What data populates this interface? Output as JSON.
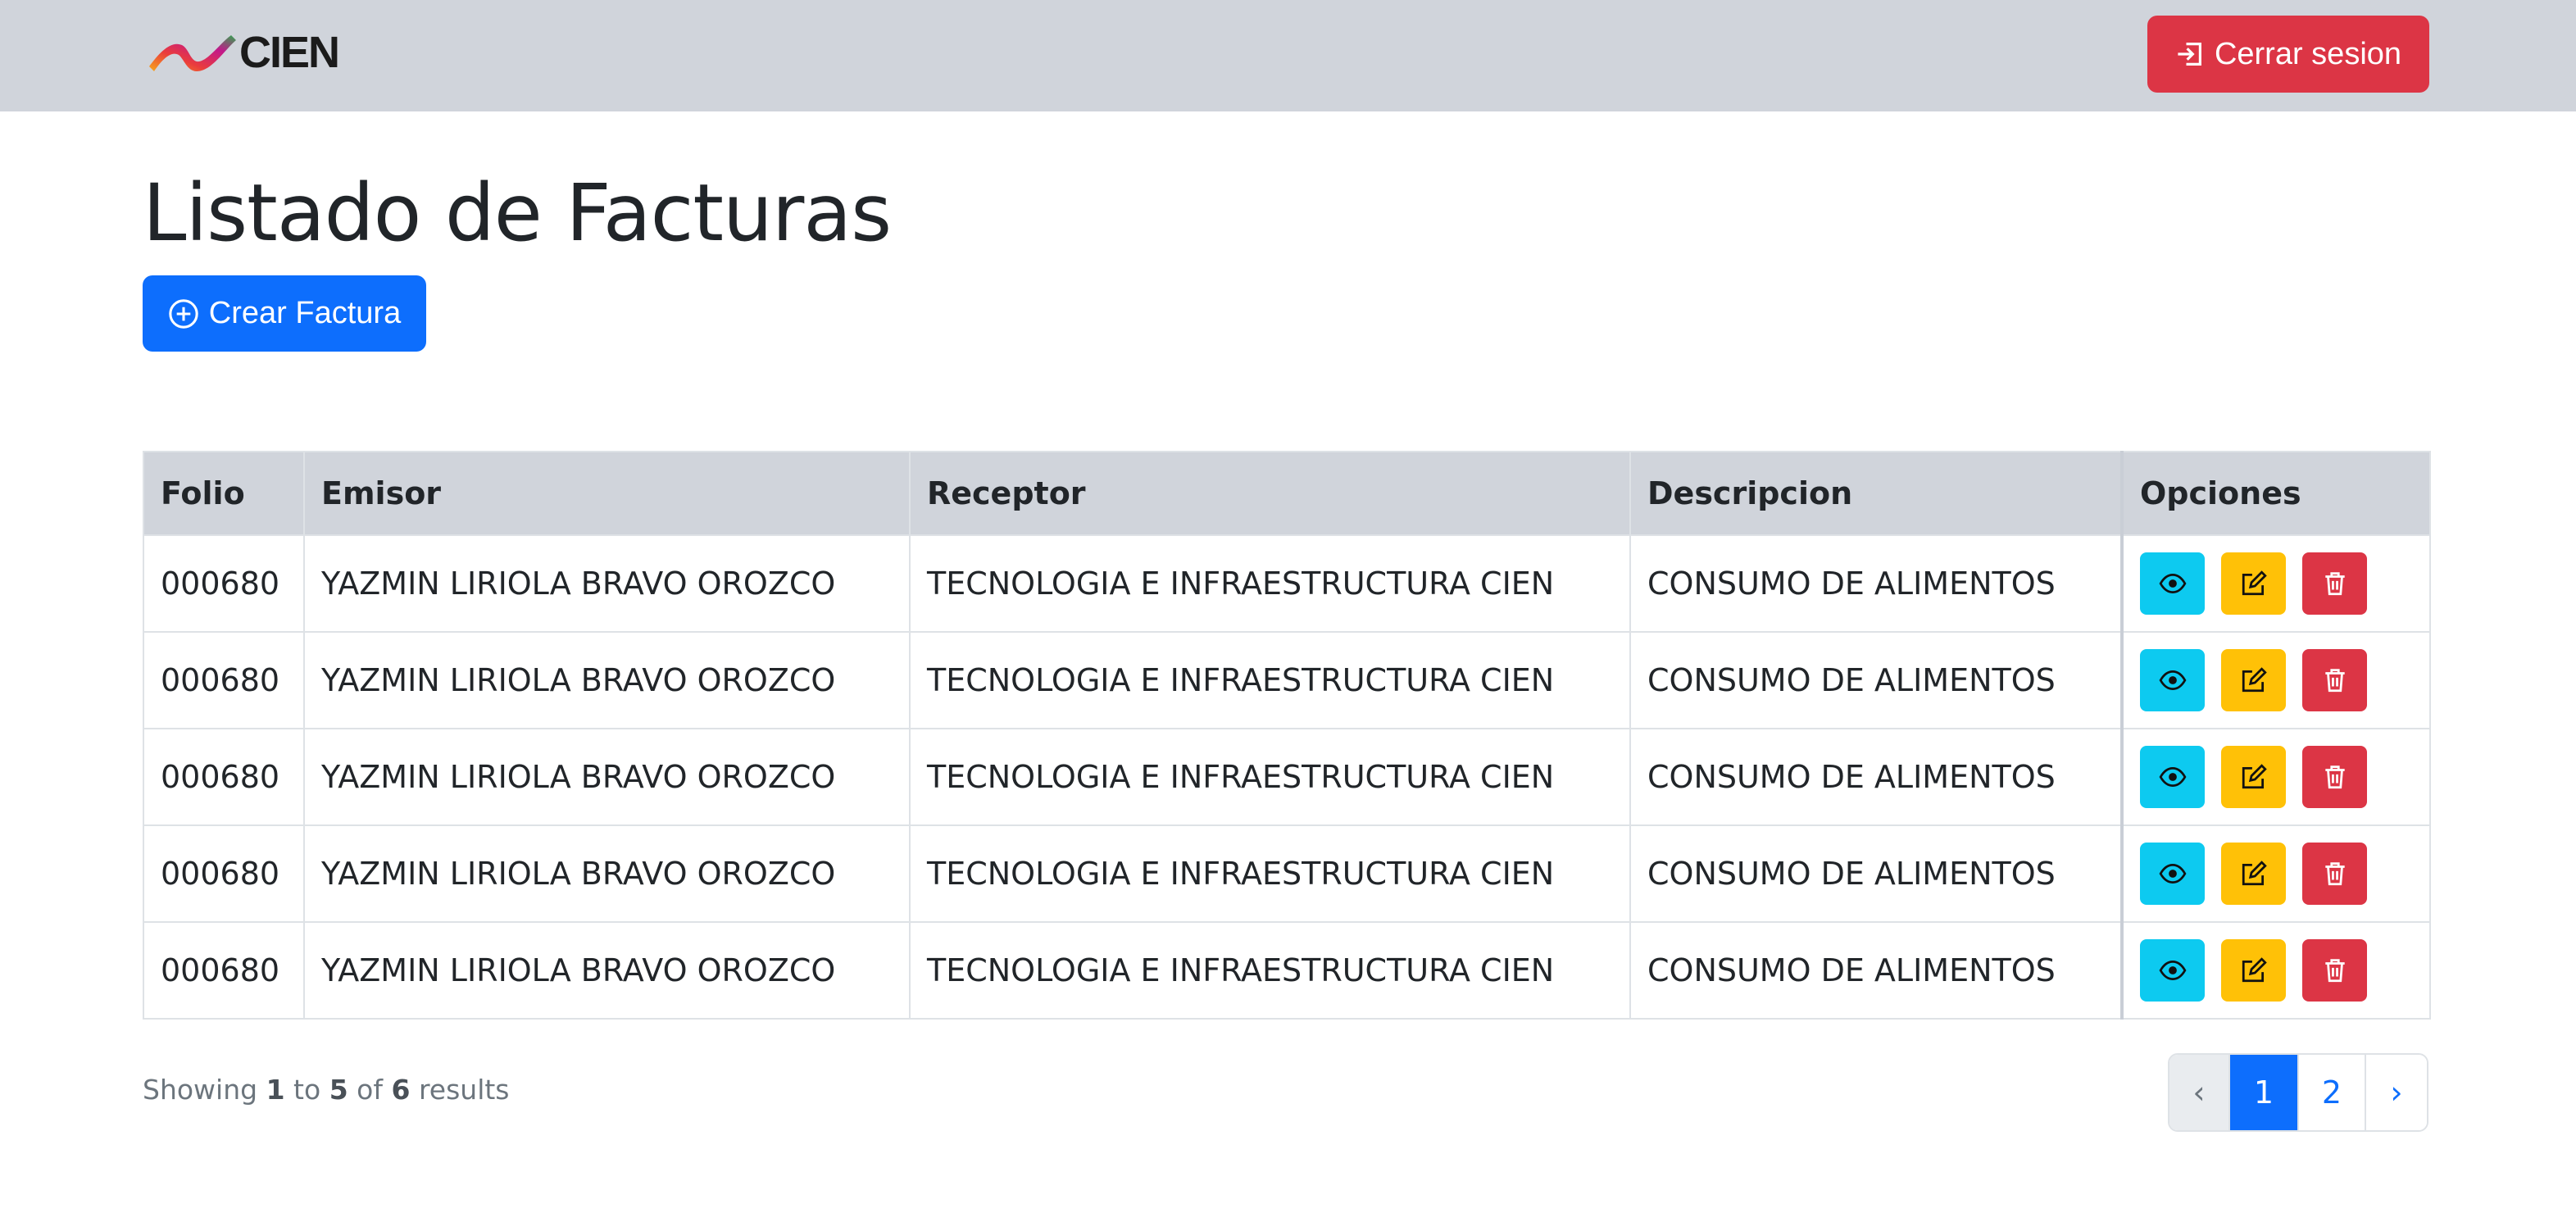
{
  "header": {
    "logo_text": "CIEN",
    "logout_label": "Cerrar sesion"
  },
  "main": {
    "title": "Listado de Facturas",
    "create_label": "Crear Factura"
  },
  "table": {
    "columns": [
      "Folio",
      "Emisor",
      "Receptor",
      "Descripcion",
      "Opciones"
    ],
    "rows": [
      {
        "folio": "000680",
        "emisor": "YAZMIN LIRIOLA BRAVO OROZCO",
        "receptor": "TECNOLOGIA E INFRAESTRUCTURA CIEN",
        "descripcion": "CONSUMO DE ALIMENTOS"
      },
      {
        "folio": "000680",
        "emisor": "YAZMIN LIRIOLA BRAVO OROZCO",
        "receptor": "TECNOLOGIA E INFRAESTRUCTURA CIEN",
        "descripcion": "CONSUMO DE ALIMENTOS"
      },
      {
        "folio": "000680",
        "emisor": "YAZMIN LIRIOLA BRAVO OROZCO",
        "receptor": "TECNOLOGIA E INFRAESTRUCTURA CIEN",
        "descripcion": "CONSUMO DE ALIMENTOS"
      },
      {
        "folio": "000680",
        "emisor": "YAZMIN LIRIOLA BRAVO OROZCO",
        "receptor": "TECNOLOGIA E INFRAESTRUCTURA CIEN",
        "descripcion": "CONSUMO DE ALIMENTOS"
      },
      {
        "folio": "000680",
        "emisor": "YAZMIN LIRIOLA BRAVO OROZCO",
        "receptor": "TECNOLOGIA E INFRAESTRUCTURA CIEN",
        "descripcion": "CONSUMO DE ALIMENTOS"
      }
    ],
    "row_actions": [
      "eye-icon",
      "edit-icon",
      "trash-icon"
    ]
  },
  "footer": {
    "showing_prefix": "Showing",
    "from": "1",
    "to_word": "to",
    "to": "5",
    "of_word": "of",
    "total": "6",
    "results_word": "results"
  },
  "pagination": {
    "prev": "‹",
    "pages": [
      "1",
      "2"
    ],
    "current": "1",
    "next": "›"
  },
  "colors": {
    "navbar_bg": "#d0d4db",
    "primary": "#0d6efd",
    "danger": "#dc3545",
    "info": "#0dcaf0",
    "warning": "#ffc107"
  }
}
